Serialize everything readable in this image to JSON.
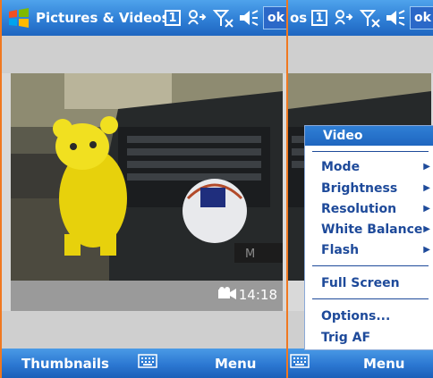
{
  "left": {
    "title": "Pictures & Videos",
    "badge": "1",
    "ok_label": "ok",
    "counter_time": "14:18",
    "softkeys": {
      "left": "Thumbnails",
      "right": "Menu"
    }
  },
  "right": {
    "title_fragment": "os",
    "badge": "1",
    "ok_label": "ok",
    "softkeys": {
      "right": "Menu"
    },
    "menu": {
      "header": "Video",
      "items": [
        {
          "label": "Mode",
          "submenu": true
        },
        {
          "label": "Brightness",
          "submenu": true
        },
        {
          "label": "Resolution",
          "submenu": true
        },
        {
          "label": "White Balance",
          "submenu": true
        },
        {
          "label": "Flash",
          "submenu": true
        },
        {
          "label": "Full Screen",
          "submenu": false
        },
        {
          "label": "Options...",
          "submenu": false
        },
        {
          "label": "Trig AF",
          "submenu": false
        }
      ]
    }
  },
  "icons": [
    "windows-start-icon",
    "connectivity-icon",
    "signal-off-icon",
    "volume-icon",
    "video-camera-icon",
    "keyboard-icon",
    "submenu-arrow-icon"
  ],
  "colors": {
    "titlebar": "#2f7fd6",
    "accent_border": "#f07820",
    "menu_text": "#1e4a9a"
  }
}
